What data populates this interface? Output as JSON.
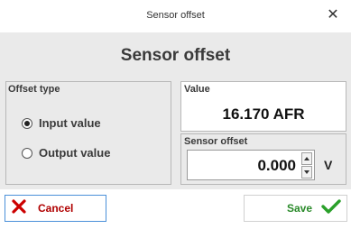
{
  "window": {
    "title": "Sensor offset",
    "close_icon": "close-icon"
  },
  "heading": "Sensor offset",
  "offset_type": {
    "label": "Offset type",
    "options": [
      {
        "label": "Input value",
        "selected": true
      },
      {
        "label": "Output value",
        "selected": false
      }
    ]
  },
  "value_box": {
    "label": "Value",
    "value": "16.170 AFR"
  },
  "sensor_offset": {
    "label": "Sensor offset",
    "value": "0.000",
    "unit": "V"
  },
  "buttons": {
    "cancel_label": "Cancel",
    "cancel_icon": "x-icon",
    "save_label": "Save",
    "save_icon": "checkmark-icon"
  },
  "colors": {
    "cancel_text": "#b00000",
    "cancel_icon": "#cc0000",
    "save_text": "#2a8a2a",
    "save_icon": "#2aa02a",
    "cancel_border": "#4a90d9"
  }
}
